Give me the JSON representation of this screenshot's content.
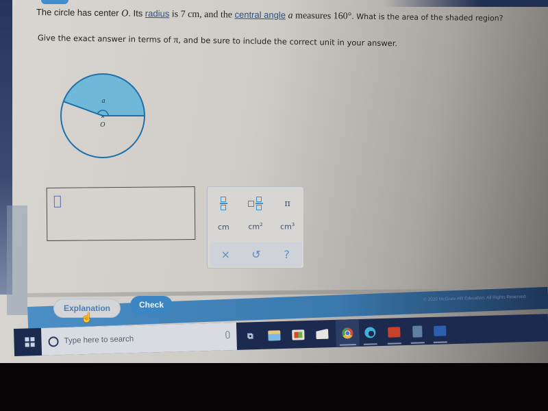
{
  "question": {
    "line1": {
      "t1": "The circle has center ",
      "center": "O",
      "t2": ". Its ",
      "radius_link": "radius",
      "t3": " is 7 cm, and the ",
      "angle_link": "central angle",
      "t4": " ",
      "angle_var": "a",
      "t5": " measures 160°",
      "t6": ". What is the area of the shaded region?"
    },
    "line2": {
      "t1": "Give the exact answer in terms of ",
      "pi": "π",
      "t2": ", and be sure to include the correct unit in your answer."
    }
  },
  "figure": {
    "angle_label": "a",
    "center_label": "O",
    "central_angle_deg": 160,
    "shade_color": "#6fb8d8",
    "stroke_color": "#1f6fa8"
  },
  "answer": {
    "value": ""
  },
  "keypad": {
    "pi": "π",
    "units": [
      {
        "base": "cm",
        "exp": ""
      },
      {
        "base": "cm",
        "exp": "2"
      },
      {
        "base": "cm",
        "exp": "3"
      }
    ],
    "actions": {
      "clear": "×",
      "undo": "↺",
      "help": "?"
    }
  },
  "buttons": {
    "explanation": "Explanation",
    "check": "Check"
  },
  "footer": {
    "copyright": "© 2020 McGraw-Hill Education. All Rights Reserved."
  },
  "taskbar": {
    "search_placeholder": "Type here to search"
  }
}
